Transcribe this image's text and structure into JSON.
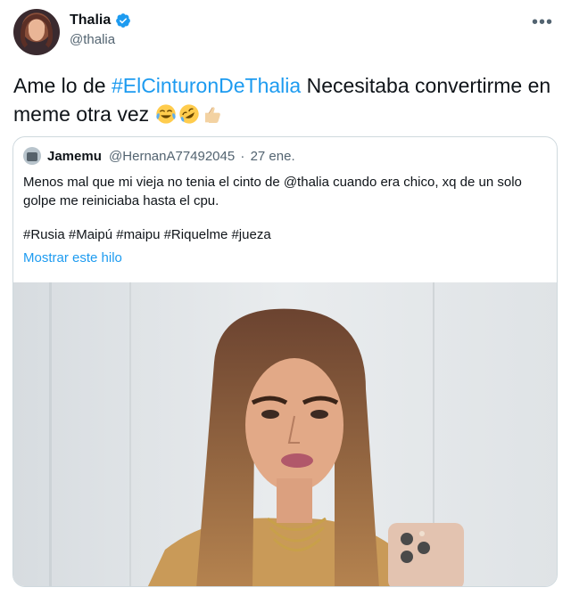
{
  "author": {
    "name": "Thalia",
    "handle": "@thalia",
    "verified": true
  },
  "tweet": {
    "text_start": "Ame lo de ",
    "hashtag": "#ElCinturonDeThalia",
    "text_end": " Necesitaba convertirme en meme otra vez ",
    "emojis": [
      "face-with-tears-of-joy",
      "rolling-on-floor-laughing",
      "thumbs-up"
    ]
  },
  "quoted": {
    "name": "Jamemu",
    "handle": "@HernanA77492045",
    "separator": "·",
    "date": "27 ene.",
    "body": "Menos mal que mi vieja no tenia el cinto de @thalia cuando era chico, xq de un solo golpe me reiniciaba hasta el cpu.",
    "tags": "#Rusia #Maipú #maipu #Riquelme #jueza",
    "show_thread": "Mostrar este hilo"
  },
  "colors": {
    "accent": "#1d9bf0",
    "text": "#0f1419",
    "muted": "#536471",
    "border": "#cfd9de"
  },
  "icons": {
    "more": "more-dots-icon",
    "verified": "verified-badge-icon"
  }
}
